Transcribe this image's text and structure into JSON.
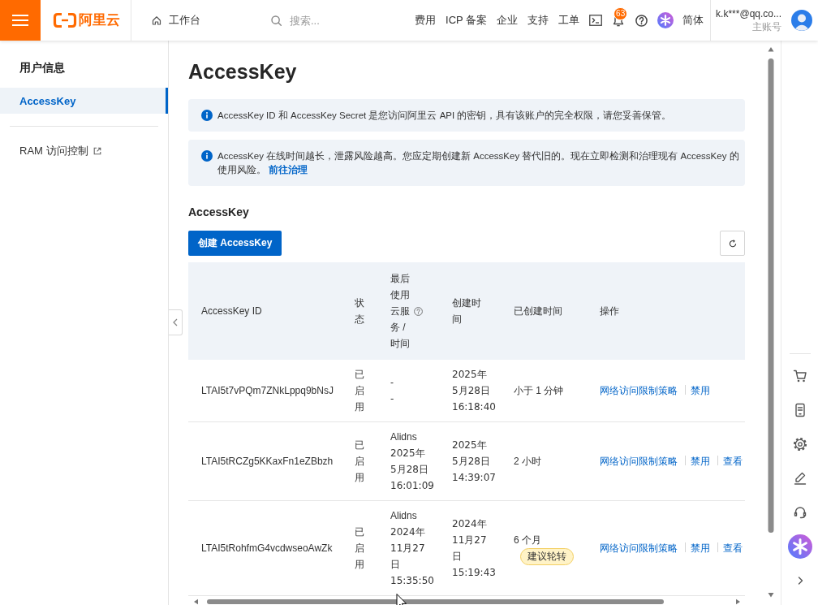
{
  "top_bar": {
    "logo": "阿里云",
    "workbench": "工作台",
    "search": {
      "placeholder": "搜索..."
    },
    "nav": [
      "费用",
      "ICP 备案",
      "企业",
      "支持",
      "工单"
    ],
    "notifications": {
      "count": "63"
    },
    "language": "简体",
    "account": {
      "name": "k.k***@qq.co...",
      "role": "主账号"
    }
  },
  "sidebar": {
    "groups": [
      {
        "title": "用户信息",
        "items": [
          {
            "label": "AccessKey",
            "selected": true,
            "external": false
          }
        ]
      },
      {
        "items": [
          {
            "label": "RAM 访问控制",
            "selected": false,
            "external": true
          }
        ]
      }
    ]
  },
  "page": {
    "title": "AccessKey",
    "alerts": [
      {
        "text": "AccessKey ID 和 AccessKey Secret 是您访问阿里云 API 的密钥，具有该账户的完全权限，请您妥善保管。"
      },
      {
        "text": "AccessKey 在线时间越长，泄露风险越高。您应定期创建新 AccessKey 替代旧的。现在立即检测和治理现有 AccessKey 的使用风险。",
        "link": "前往治理"
      }
    ],
    "section_title": "AccessKey",
    "create_button": "创建 AccessKey"
  },
  "table": {
    "columns": [
      {
        "label": "AccessKey ID",
        "help": false
      },
      {
        "label": "状态",
        "help": false
      },
      {
        "label": "最后使用云服务 / 时间",
        "help": true
      },
      {
        "label": "创建时间",
        "help": false
      },
      {
        "label": "已创建时间",
        "help": false
      },
      {
        "label": "操作",
        "help": false
      }
    ],
    "rows": [
      {
        "id": "LTAI5t7vPQm7ZNkLppq9bNsJ",
        "status": "已启用",
        "last_used": {
          "service": "-",
          "time": "-"
        },
        "created": "2025年5月28日 16:18:40",
        "age": "小于 1 分钟",
        "actions": [
          "网络访问限制策略",
          "禁用"
        ]
      },
      {
        "id": "LTAI5tRCZg5KKaxFn1eZBbzh",
        "status": "已启用",
        "last_used": {
          "service": "Alidns",
          "time": "2025年5月28日 16:01:09"
        },
        "created": "2025年5月28日 14:39:07",
        "age": "2 小时",
        "actions": [
          "网络访问限制策略",
          "禁用",
          "查看"
        ]
      },
      {
        "id": "LTAI5tRohfmG4vcdwseoAwZk",
        "status": "已启用",
        "last_used": {
          "service": "Alidns",
          "time": "2024年11月27日 15:35:50"
        },
        "created": "2024年11月27日 15:19:43",
        "age": "6 个月",
        "badge": "建议轮转",
        "actions": [
          "网络访问限制策略",
          "禁用",
          "查看"
        ]
      }
    ]
  }
}
